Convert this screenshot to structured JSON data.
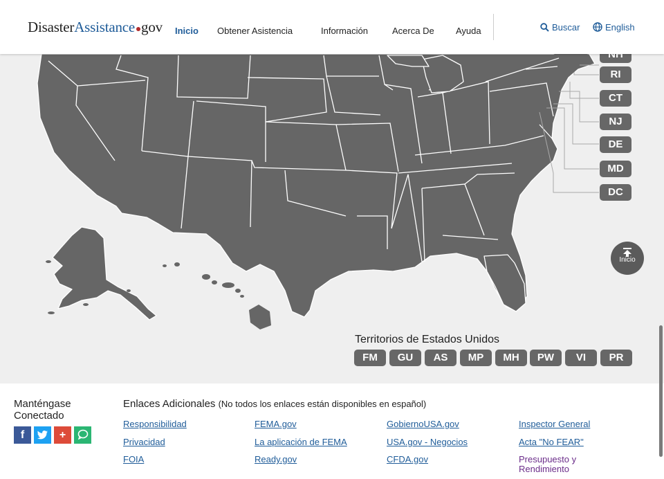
{
  "header": {
    "logo": {
      "part1": "Disaster",
      "part2": "Assistance",
      "part3": "gov"
    },
    "nav": [
      {
        "label": "Inicio",
        "active": true
      },
      {
        "label": "Obtener Asistencia"
      },
      {
        "label": "Información"
      },
      {
        "label": "Acerca De"
      },
      {
        "label": "Ayuda"
      }
    ],
    "search_label": "Buscar",
    "language_label": "English"
  },
  "map": {
    "state_buttons": [
      "NH",
      "RI",
      "CT",
      "NJ",
      "DE",
      "MD",
      "DC"
    ],
    "top_button_label": "Inicio",
    "territories_title": "Territorios de Estados Unidos",
    "territories": [
      "FM",
      "GU",
      "AS",
      "MP",
      "MH",
      "PW",
      "VI",
      "PR"
    ]
  },
  "footer": {
    "connect_title": "Manténgase Conectado",
    "social": [
      {
        "name": "facebook-icon",
        "glyph": "f",
        "color": "#3b5998"
      },
      {
        "name": "twitter-icon",
        "glyph": "t",
        "color": "#1da1f2"
      },
      {
        "name": "google-plus-icon",
        "glyph": "+",
        "color": "#dd4b39"
      },
      {
        "name": "chat-icon",
        "glyph": "",
        "color": "#2bb673"
      }
    ],
    "links_title": "Enlaces Adicionales",
    "links_note": "(No todos los enlaces están disponibles en español)",
    "links": {
      "col1": [
        "Responsibilidad",
        "Privacidad",
        "FOIA"
      ],
      "col2": [
        "FEMA.gov",
        "La aplicación de FEMA",
        "Ready.gov"
      ],
      "col3": [
        "GobiernoUSA.gov",
        "USA.gov - Negocios",
        "CFDA.gov"
      ],
      "col4": [
        "Inspector General",
        "Acta \"No FEAR\"",
        "Presupuesto y Rendimiento"
      ]
    }
  },
  "colors": {
    "accent": "#1f5c99",
    "state_fill": "#666666",
    "button_fill": "#676767",
    "visited_link": "#6b2d8a"
  }
}
